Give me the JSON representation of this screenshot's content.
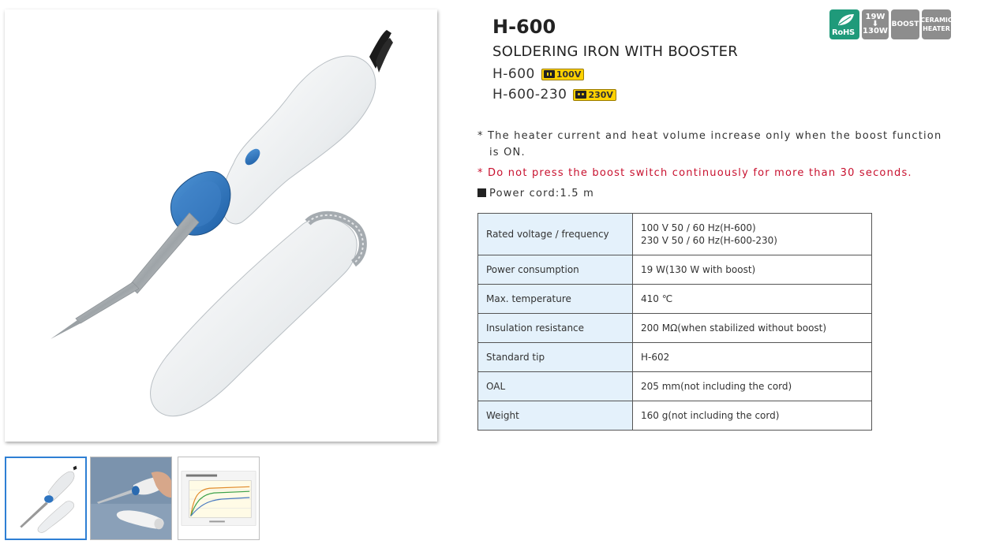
{
  "product": {
    "model": "H-600",
    "name": "SOLDERING IRON WITH BOOSTER",
    "variants": [
      {
        "model": "H-600",
        "voltage": "100V",
        "plug_icon": "flat-plug-icon"
      },
      {
        "model": "H-600-230",
        "voltage": "230V",
        "plug_icon": "round-plug-icon"
      }
    ]
  },
  "badges": {
    "rohs": "RoHS",
    "watt_low": "19W",
    "watt_arrow": "⬇",
    "watt_high": "130W",
    "boost": "BOOST",
    "ceramic_1": "CERAMIC",
    "ceramic_2": "HEATER"
  },
  "notes": {
    "note1": "* The heater current and heat volume increase only when the boost function is ON.",
    "note2": "* Do not press the boost switch continuously for more than 30 seconds.",
    "note3": "Power cord:1.5 m"
  },
  "specs": [
    {
      "label": "Rated voltage / frequency",
      "value_1": "100 V 50 / 60 Hz(H-600)",
      "value_2": "230 V 50 / 60 Hz(H-600-230)"
    },
    {
      "label": "Power consumption",
      "value_1": "19 W(130 W with boost)"
    },
    {
      "label": "Max. temperature",
      "value_1": "410 ℃"
    },
    {
      "label": "Insulation resistance",
      "value_1": "200 MΩ(when stabilized without boost)"
    },
    {
      "label": "Standard tip",
      "value_1": "H-602"
    },
    {
      "label": "OAL",
      "value_1": "205 mm(not including the cord)"
    },
    {
      "label": "Weight",
      "value_1": "160 g(not including the cord)"
    }
  ],
  "gallery": {
    "selected_index": 0,
    "thumbnails": [
      "product-photo",
      "in-hand-photo",
      "temperature-chart"
    ]
  },
  "colors": {
    "accent_blue": "#2e7fd4",
    "rohs_green": "#1f9a7a",
    "warning_red": "#c8102e",
    "table_label_bg": "#e4f1fb",
    "voltage_badge": "#ffd200"
  }
}
